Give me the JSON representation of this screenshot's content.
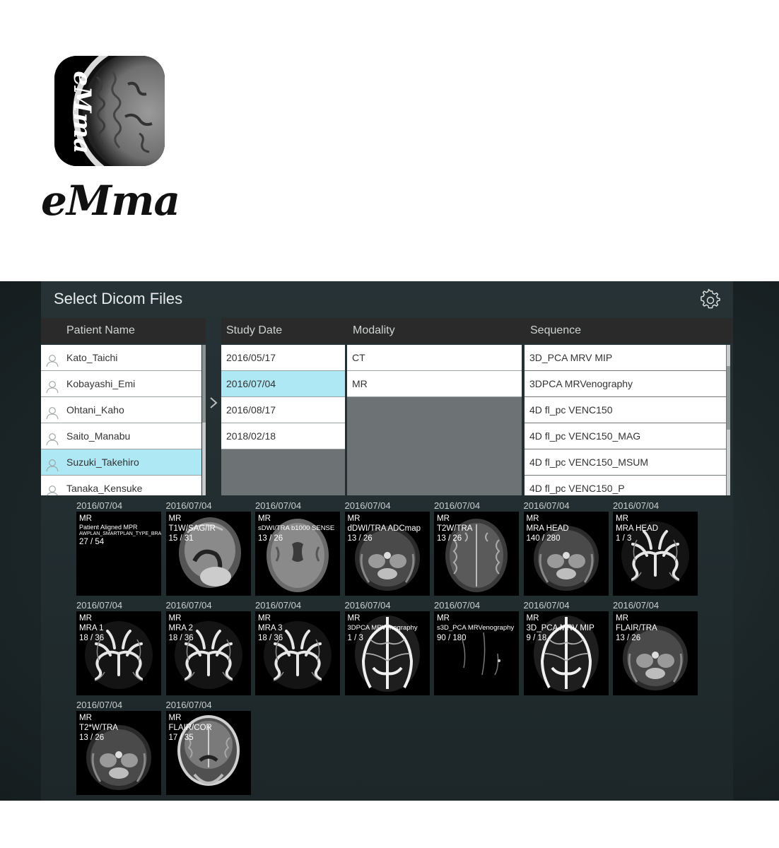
{
  "app": {
    "logo_text": "eMma",
    "title": "Select Dicom Files"
  },
  "icons": {
    "settings": "gear-icon",
    "patient": "person-icon",
    "expand": "chevron-right-icon"
  },
  "colors": {
    "selected_row": "#aee8f4",
    "panel_bg": "#263235",
    "header_bg": "#2a2a2a"
  },
  "headers": {
    "patient_name": "Patient Name",
    "study_date": "Study Date",
    "modality": "Modality",
    "sequence": "Sequence"
  },
  "patients": [
    {
      "name": "Kato_Taichi",
      "selected": false
    },
    {
      "name": "Kobayashi_Emi",
      "selected": false
    },
    {
      "name": "Ohtani_Kaho",
      "selected": false
    },
    {
      "name": "Saito_Manabu",
      "selected": false
    },
    {
      "name": "Suzuki_Takehiro",
      "selected": true
    },
    {
      "name": "Tanaka_Kensuke",
      "selected": false
    }
  ],
  "study_dates": [
    {
      "date": "2016/05/17",
      "selected": false
    },
    {
      "date": "2016/07/04",
      "selected": true
    },
    {
      "date": "2016/08/17",
      "selected": false
    },
    {
      "date": "2018/02/18",
      "selected": false
    }
  ],
  "modalities": [
    {
      "name": "CT"
    },
    {
      "name": "MR"
    }
  ],
  "sequences": [
    {
      "name": "3D_PCA MRV MIP"
    },
    {
      "name": "3DPCA   MRVenography"
    },
    {
      "name": "4D fl_pc VENC150"
    },
    {
      "name": "4D fl_pc VENC150_MAG"
    },
    {
      "name": "4D fl_pc VENC150_MSUM"
    },
    {
      "name": "4D fl_pc VENC150_P"
    }
  ],
  "thumbnails": [
    {
      "date": "2016/07/04",
      "modality": "MR",
      "series_line1": "Patient Aligned MPR",
      "series_line2": "AWPLAN_SMARTPLAN_TYPE_BRAIN",
      "count": "27 / 54",
      "kind": "blank"
    },
    {
      "date": "2016/07/04",
      "modality": "MR",
      "series": "T1W/SAG/IR",
      "count": "15 / 31",
      "kind": "sag"
    },
    {
      "date": "2016/07/04",
      "modality": "MR",
      "series": "sDWI/TRA b1000 SENSE",
      "count": "13 / 26",
      "kind": "axial-gray"
    },
    {
      "date": "2016/07/04",
      "modality": "MR",
      "series": "dDWI/TRA  ADCmap",
      "count": "13 / 26",
      "kind": "axial-low"
    },
    {
      "date": "2016/07/04",
      "modality": "MR",
      "series": "T2W/TRA",
      "count": "13 / 26",
      "kind": "axial-t2"
    },
    {
      "date": "2016/07/04",
      "modality": "MR",
      "series": "MRA HEAD",
      "count": "140 / 280",
      "kind": "axial-low"
    },
    {
      "date": "2016/07/04",
      "modality": "MR",
      "series": "MRA HEAD",
      "count": "1 / 3",
      "kind": "mra"
    },
    {
      "date": "2016/07/04",
      "modality": "MR",
      "series": "MRA 1",
      "count": "18 / 36",
      "kind": "mra"
    },
    {
      "date": "2016/07/04",
      "modality": "MR",
      "series": "MRA 2",
      "count": "18 / 36",
      "kind": "mra"
    },
    {
      "date": "2016/07/04",
      "modality": "MR",
      "series": "MRA 3",
      "count": "18 / 36",
      "kind": "mra"
    },
    {
      "date": "2016/07/04",
      "modality": "MR",
      "series": "3DPCA   MRVenography",
      "count": "1 / 3",
      "kind": "mrv"
    },
    {
      "date": "2016/07/04",
      "modality": "MR",
      "series": "s3D_PCA MRVenography",
      "count": "90 / 180",
      "kind": "dark"
    },
    {
      "date": "2016/07/04",
      "modality": "MR",
      "series": "3D_PCA MRV MIP",
      "count": "9 / 18",
      "kind": "mrv"
    },
    {
      "date": "2016/07/04",
      "modality": "MR",
      "series": "FLAIR/TRA",
      "count": "13 / 26",
      "kind": "axial-low"
    },
    {
      "date": "2016/07/04",
      "modality": "MR",
      "series": "T2*W/TRA",
      "count": "13 / 26",
      "kind": "axial-low"
    },
    {
      "date": "2016/07/04",
      "modality": "MR",
      "series": "FLAIR/COR",
      "count": "17 / 35",
      "kind": "coronal"
    }
  ]
}
